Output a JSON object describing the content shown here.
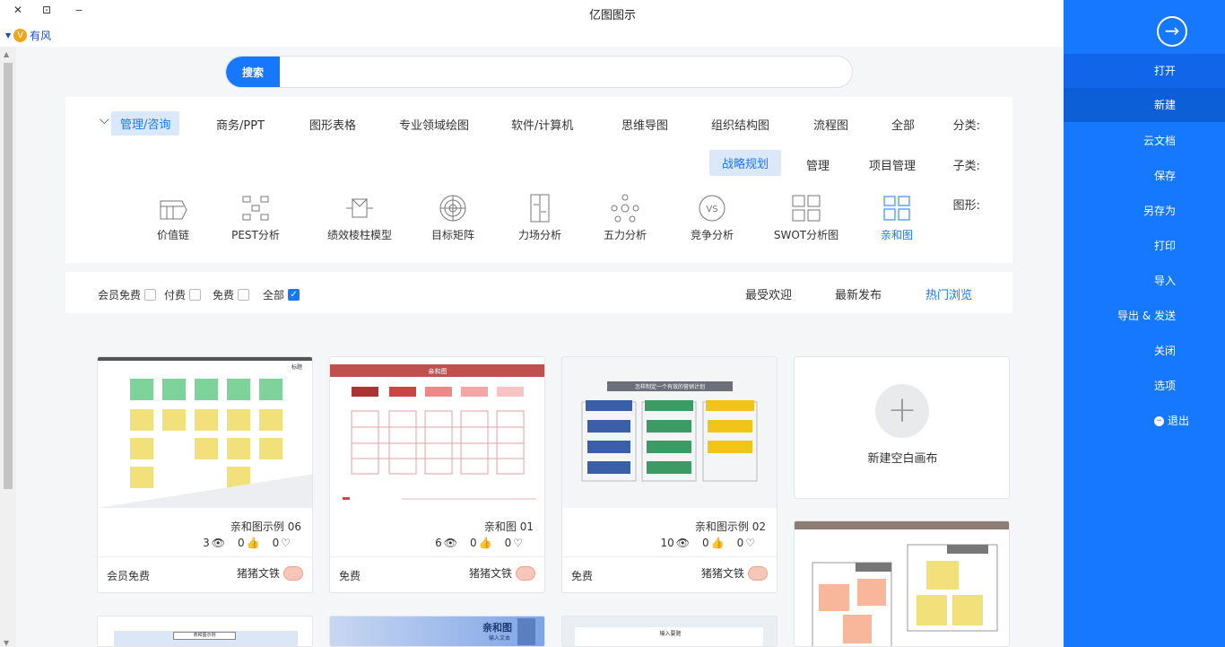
{
  "window": {
    "title": "亿图图示",
    "min": "‒",
    "restore": "⊡",
    "close": "✕"
  },
  "brand": {
    "name": "有风",
    "badge": "V"
  },
  "search": {
    "button": "搜索",
    "placeholder": ""
  },
  "filter": {
    "category_label": "分类:",
    "categories": [
      "全部",
      "流程图",
      "组织结构图",
      "思维导图",
      "软件/计算机",
      "专业领域绘图",
      "图形表格",
      "商务/PPT",
      "管理/咨询"
    ],
    "sub_label": "子类:",
    "subcategories": [
      "项目管理",
      "管理",
      "战略规划"
    ],
    "shape_label": "图形:",
    "shapes": [
      "亲和图",
      "SWOT分析图",
      "竞争分析",
      "五力分析",
      "力场分析",
      "目标矩阵",
      "绩效棱柱模型",
      "PEST分析",
      "价值链"
    ]
  },
  "sort": {
    "options": [
      "热门浏览",
      "最新发布",
      "最受欢迎"
    ],
    "checks": [
      {
        "label": "全部",
        "checked": true
      },
      {
        "label": "免费",
        "checked": false
      },
      {
        "label": "付费",
        "checked": false
      },
      {
        "label": "会员免费",
        "checked": false
      }
    ]
  },
  "blank_card": {
    "label": "新建空白画布"
  },
  "cards": [
    {
      "title": "亲和图示例 02",
      "views": "10",
      "likes": "0",
      "favs": "0",
      "author": "猪猪文铁",
      "price": "免费",
      "heading": "怎样制定一个有效的营销计划"
    },
    {
      "title": "亲和图 01",
      "views": "6",
      "likes": "0",
      "favs": "0",
      "author": "猪猪文铁",
      "price": "免费",
      "heading": "亲和图"
    },
    {
      "title": "亲和图示例 06",
      "views": "3",
      "likes": "0",
      "favs": "0",
      "author": "猪猪文铁",
      "price": "会员免费",
      "heading": "标题"
    }
  ],
  "partial_cards": {
    "p1_heading": "亲和图",
    "p1_sub": "输入文本",
    "p2_heading": "亲和图示例",
    "p3_heading": "输入要题"
  },
  "sidebar": {
    "items": [
      "打开",
      "新建",
      "云文档",
      "保存",
      "另存为",
      "打印",
      "导入",
      "导出 & 发送",
      "关闭",
      "选项",
      "退出"
    ]
  }
}
